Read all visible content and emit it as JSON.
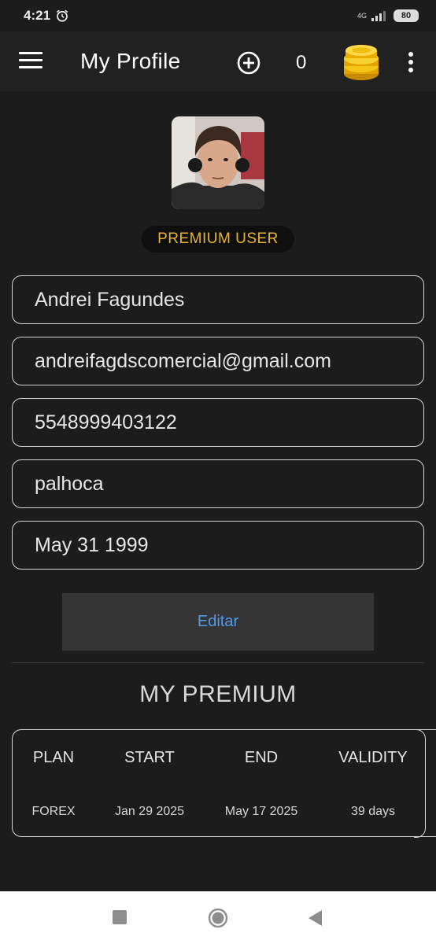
{
  "status_bar": {
    "time": "4:21",
    "network": "4G",
    "battery": "80"
  },
  "app_bar": {
    "title": "My Profile",
    "coin_count": "0"
  },
  "profile": {
    "badge": "PREMIUM USER",
    "fields": {
      "name": "Andrei Fagundes",
      "email": "andreifagdscomercial@gmail.com",
      "phone": "5548999403122",
      "city": "palhoca",
      "birthdate": "May 31 1999"
    },
    "edit_label": "Editar"
  },
  "premium": {
    "title": "MY PREMIUM",
    "columns": [
      "PLAN",
      "START",
      "END",
      "VALIDITY"
    ],
    "row": [
      "FOREX",
      "Jan 29 2025",
      "May 17 2025",
      "39 days"
    ]
  },
  "colors": {
    "background": "#1c1c1c",
    "app_bar": "#212121",
    "badge_text": "#e8b42e",
    "edit_text": "#4f9ae8",
    "edit_bg": "#353535"
  },
  "icons": [
    "alarm-icon",
    "signal-icon",
    "battery-icon",
    "menu-icon",
    "add-circle-icon",
    "coins-icon",
    "more-vert-icon",
    "nav-recents-icon",
    "nav-home-icon",
    "nav-back-icon"
  ]
}
